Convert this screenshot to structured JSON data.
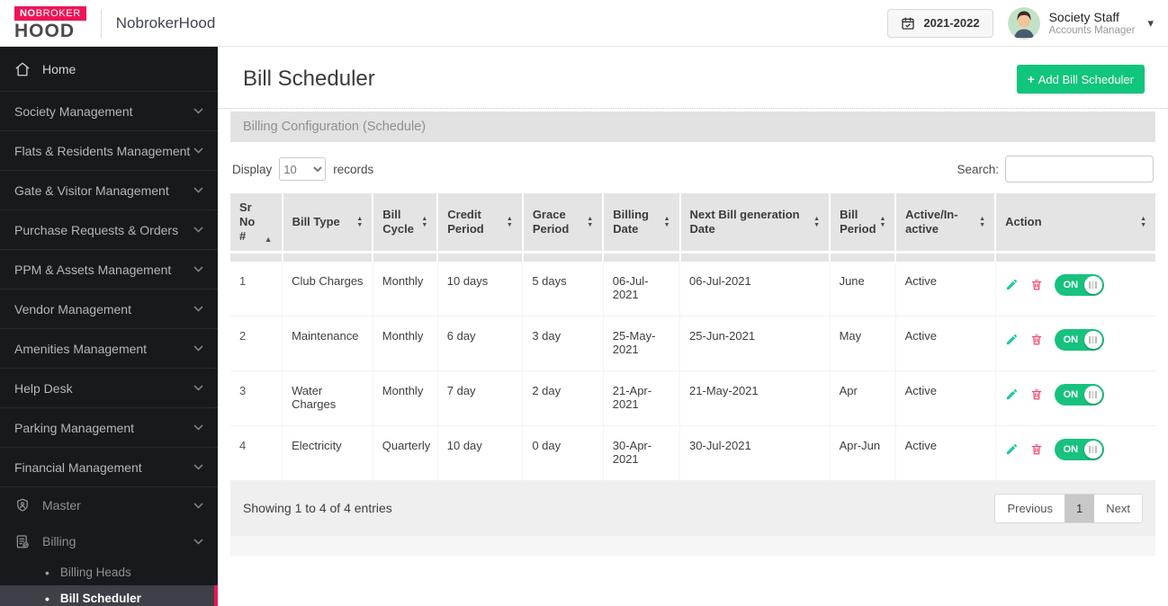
{
  "topbar": {
    "brand": {
      "line1a": "NO",
      "line1b": "BROKER",
      "line2": "HOOD"
    },
    "app_name": "NobrokerHood",
    "year_selector": "2021-2022",
    "user": {
      "name": "Society Staff",
      "role": "Accounts Manager"
    }
  },
  "sidebar": {
    "items": [
      {
        "label": "Home",
        "icon": "home-icon"
      },
      {
        "label": "Society Management"
      },
      {
        "label": "Flats & Residents Management"
      },
      {
        "label": "Gate & Visitor Management"
      },
      {
        "label": "Purchase Requests & Orders"
      },
      {
        "label": "PPM & Assets Management"
      },
      {
        "label": "Vendor Management"
      },
      {
        "label": "Amenities Management"
      },
      {
        "label": "Help Desk"
      },
      {
        "label": "Parking Management"
      },
      {
        "label": "Financial Management"
      },
      {
        "label": "Master",
        "icon": "shield-user-icon"
      },
      {
        "label": "Billing",
        "icon": "billing-clipboard-icon"
      }
    ],
    "billing_sub_items": [
      {
        "label": "Billing Heads",
        "active": false
      },
      {
        "label": "Bill Scheduler",
        "active": true
      }
    ]
  },
  "page": {
    "title": "Bill Scheduler",
    "add_button_plus": "+",
    "add_button_label": "Add Bill Scheduler",
    "section_header": "Billing Configuration (Schedule)"
  },
  "controls": {
    "display_label": "Display",
    "page_size": "10",
    "records_label": "records",
    "search_label": "Search:",
    "search_value": ""
  },
  "table": {
    "columns": [
      {
        "label": "Sr No #",
        "sort": "asc"
      },
      {
        "label": "Bill Type",
        "sort": "both"
      },
      {
        "label": "Bill Cycle",
        "sort": "both"
      },
      {
        "label": "Credit Period",
        "sort": "both"
      },
      {
        "label": "Grace Period",
        "sort": "both"
      },
      {
        "label": "Billing Date",
        "sort": "both"
      },
      {
        "label": "Next Bill generation Date",
        "sort": "both"
      },
      {
        "label": "Bill Period",
        "sort": "both"
      },
      {
        "label": "Active/In-active",
        "sort": "both"
      },
      {
        "label": "Action",
        "sort": "both"
      }
    ],
    "rows": [
      {
        "sr": "1",
        "bill_type": "Club Charges",
        "bill_cycle": "Monthly",
        "credit_period": "10 days",
        "grace_period": "5 days",
        "billing_date": "06-Jul-2021",
        "next_bill_date": "06-Jul-2021",
        "bill_period": "June",
        "status": "Active",
        "toggle": "ON"
      },
      {
        "sr": "2",
        "bill_type": "Maintenance",
        "bill_cycle": "Monthly",
        "credit_period": "6 day",
        "grace_period": "3 day",
        "billing_date": "25-May-2021",
        "next_bill_date": "25-Jun-2021",
        "bill_period": "May",
        "status": "Active",
        "toggle": "ON"
      },
      {
        "sr": "3",
        "bill_type": "Water Charges",
        "bill_cycle": "Monthly",
        "credit_period": "7 day",
        "grace_period": "2 day",
        "billing_date": "21-Apr-2021",
        "next_bill_date": "21-May-2021",
        "bill_period": "Apr",
        "status": "Active",
        "toggle": "ON"
      },
      {
        "sr": "4",
        "bill_type": "Electricity",
        "bill_cycle": "Quarterly",
        "credit_period": "10 day",
        "grace_period": "0 day",
        "billing_date": "30-Apr-2021",
        "next_bill_date": "30-Jul-2021",
        "bill_period": "Apr-Jun",
        "status": "Active",
        "toggle": "ON"
      }
    ],
    "summary": "Showing 1 to 4 of 4 entries"
  },
  "pagination": {
    "previous": "Previous",
    "page": "1",
    "next": "Next"
  },
  "colors": {
    "brand_pink": "#ed1557",
    "button_green": "#10c57c",
    "toggle_green": "#17c27e",
    "edit_teal": "#1fc8a4",
    "delete_pink": "#f43f6b",
    "sidebar_bg": "#17191d",
    "sidebar_active_bg": "#3d4046",
    "table_header_gray": "#e4e4e4",
    "section_bar_gray": "#e2e2e2",
    "footer_gray": "#efefef"
  }
}
